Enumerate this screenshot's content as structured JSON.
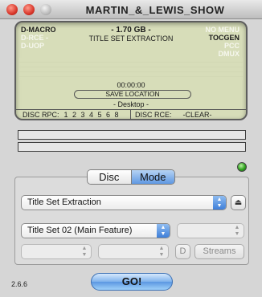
{
  "window": {
    "title": "MARTIN_&_LEWIS_SHOW"
  },
  "display": {
    "left_flags": [
      {
        "label": "D-MACRO",
        "active": true
      },
      {
        "label": "D-RCE -",
        "active": false
      },
      {
        "label": "D-UOP",
        "active": false
      }
    ],
    "right_flags": [
      {
        "label": "NO MENU",
        "active": false
      },
      {
        "label": "TOCGEN",
        "active": true
      },
      {
        "label": "PCC",
        "active": false
      },
      {
        "label": "DMUX",
        "active": false
      }
    ],
    "size": "- 1.70 GB -",
    "mode": "TITLE SET EXTRACTION",
    "time": "00:00:00",
    "save_location_label": "SAVE LOCATION",
    "save_location": "- Desktop -",
    "disc_rpc_label": "DISC RPC:",
    "disc_rpc_digits": "1 2 3 4 5 6 8",
    "disc_rce_label": "DISC RCE:",
    "disc_rce_value": "-CLEAR-"
  },
  "progress": {
    "bar1": 0,
    "bar2": 0
  },
  "segmented": {
    "disc_label": "Disc",
    "mode_label": "Mode",
    "selected": "Mode"
  },
  "controls": {
    "transfer_mode": "Title Set Extraction",
    "title_set": "Title Set 02 (Main Feature)",
    "d_label": "D",
    "streams_label": "Streams"
  },
  "footer": {
    "version": "2.6.6",
    "go_label": "GO!"
  },
  "colors": {
    "lcd_background": "#d7ddb9",
    "accent_blue": "#5f98e3",
    "status_led": "#2fa21f"
  }
}
